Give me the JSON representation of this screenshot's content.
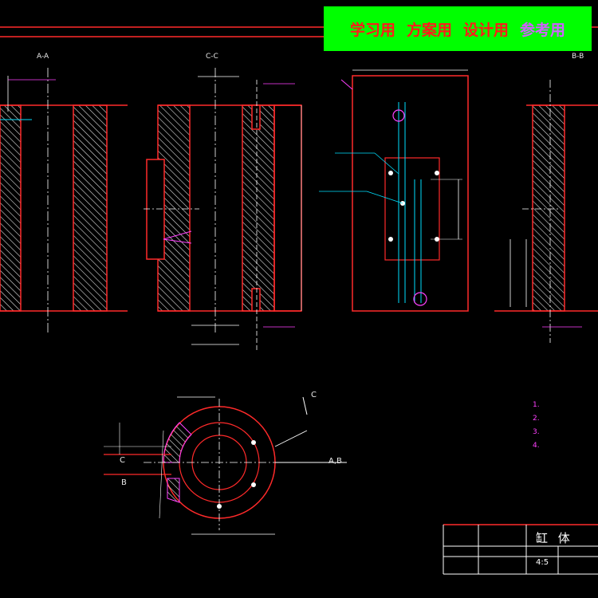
{
  "banner": {
    "words": [
      "学习用",
      "方案用",
      "设计用",
      "参考用"
    ],
    "colors": {
      "background": "#00ff00",
      "text": "#ff1a1a",
      "last_text": "#d060ff"
    }
  },
  "views": {
    "a_a": "A-A",
    "c_c": "C-C",
    "b_b": "B-B"
  },
  "section_marks": {
    "c_upper": "C",
    "c_left": "C",
    "b_left": "B",
    "ab_right": "A,B"
  },
  "tech_requirements": {
    "items": [
      "1.",
      "2.",
      "3.",
      "4."
    ]
  },
  "title_block": {
    "part_name": "缸  体",
    "scale": "4:5"
  },
  "colors": {
    "background": "#000000",
    "outline": "#ff2a2a",
    "hatch": "#e0e0e0",
    "dimension": "#ffffff",
    "centerline": "#ffffff",
    "leader": "#00e0ff",
    "accent": "#ff40ff",
    "frame": "#ff2a2a"
  }
}
